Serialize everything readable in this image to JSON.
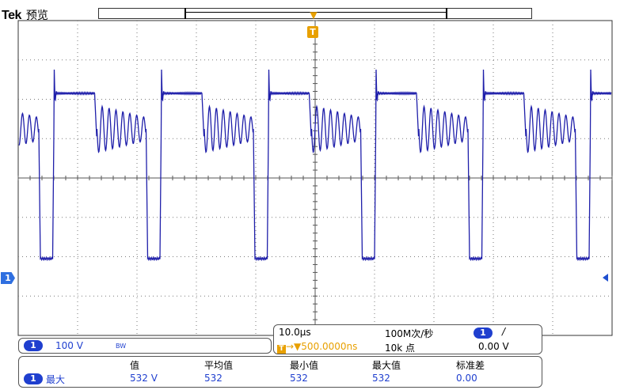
{
  "header": {
    "brand": "Tek",
    "mode": "预览"
  },
  "icons": {
    "trigger_position_marker": "▼",
    "trigger_badge": "T",
    "channel_marker": "1",
    "trigger_slope": "/"
  },
  "channel": {
    "number": "1",
    "volts_per_div": "100 V",
    "bandwidth_limit": "BW"
  },
  "timebase": {
    "time_per_div": "10.0μs",
    "sample_rate": "100M次/秒",
    "trigger_position": "500.0000ns",
    "record_length": "10k 点",
    "trigger_source": "1",
    "trigger_level": "0.00 V"
  },
  "measurement": {
    "headers": [
      "值",
      "平均值",
      "最小值",
      "最大值",
      "标准差"
    ],
    "source": "1",
    "name": "最大",
    "values": [
      "532 V",
      "532",
      "532",
      "532",
      "0.00"
    ]
  },
  "colors": {
    "trace": "#1f1faa",
    "channel_badge": "#1f3fcf",
    "trigger": "#e8a000",
    "grid": "#7a7a7a"
  }
}
